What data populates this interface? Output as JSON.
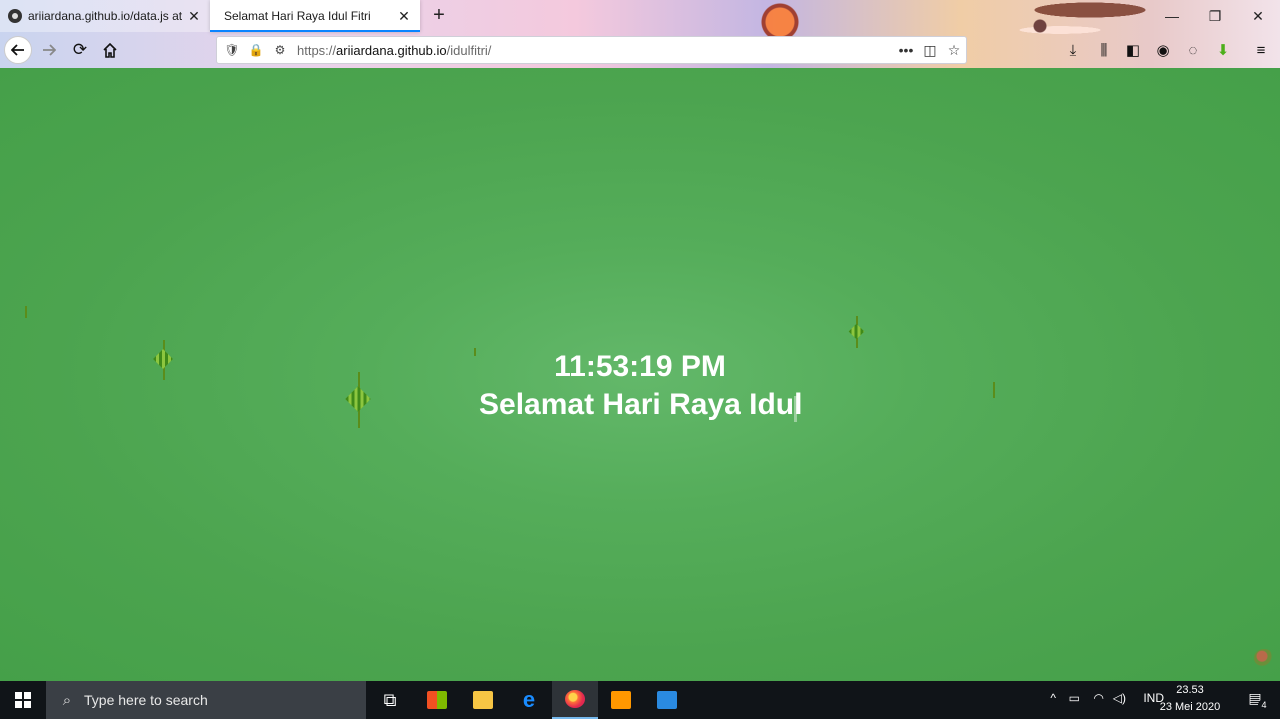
{
  "browser": {
    "tabs": [
      {
        "label": "ariiardana.github.io/data.js at m",
        "active": false,
        "icon": "github-icon"
      },
      {
        "label": "Selamat Hari Raya Idul Fitri",
        "active": true
      }
    ],
    "url_prefix": "https://",
    "url_host": "ariiardana.github.io",
    "url_path": "/idulfitri/",
    "window_controls": {
      "minimize": "—",
      "restore": "❐",
      "close": "✕"
    }
  },
  "page": {
    "clock": "11:53:19 PM",
    "greeting": "Selamat Hari Raya Idul",
    "background_color": "#4ca64f",
    "text_color": "#ffffff"
  },
  "taskbar": {
    "search_placeholder": "Type here to search",
    "language": "IND",
    "time": "23.53",
    "date": "23 Mei 2020",
    "notification_count": "4"
  }
}
